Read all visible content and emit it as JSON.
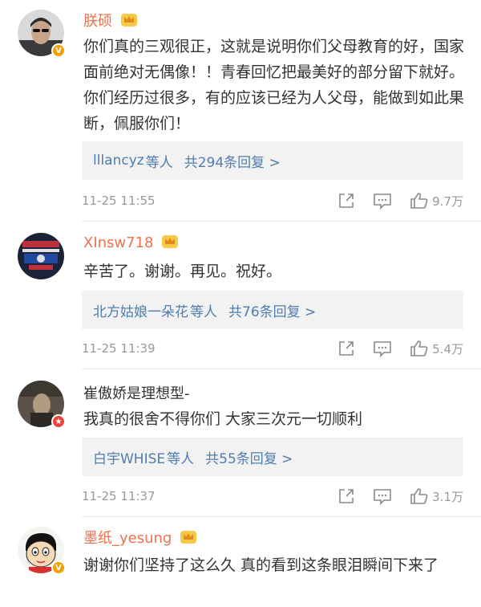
{
  "comments": [
    {
      "username": "朕硕",
      "vip": true,
      "badge": "V",
      "text": "你们真的三观很正，这就是说明你们父母教育的好，国家面前绝对无偶像！！青春回忆把最美好的部分留下就好。你们经历过很多，有的应该已经为人父母，能做到如此果断，佩服你们！",
      "reply_user": "lllancyz",
      "reply_others": "等人",
      "reply_count": "共294条回复 >",
      "time": "11-25 11:55",
      "likes": "9.7万"
    },
    {
      "username": "XInsw718",
      "vip": true,
      "badge": "",
      "text": "辛苦了。谢谢。再见。祝好。",
      "reply_user": "北方姑娘一朵花",
      "reply_others": "等人",
      "reply_count": "共76条回复 >",
      "time": "11-25 11:39",
      "likes": "5.4万"
    },
    {
      "username": "崔傲娇是理想型-",
      "vip": false,
      "badge": "★",
      "text": "我真的很舍不得你们 大家三次元一切顺利",
      "reply_user": "白宇WHISE",
      "reply_others": "等人",
      "reply_count": "共55条回复 >",
      "time": "11-25 11:37",
      "likes": "3.1万"
    },
    {
      "username": "墨纸_yesung",
      "vip": true,
      "badge": "V",
      "text": "谢谢你们坚持了这么久 真的看到这条眼泪瞬间下来了"
    }
  ],
  "colors": {
    "vip_name": "#eb7350",
    "link": "#507daf",
    "reply_bg": "#f2f2f2",
    "meta": "#999999"
  },
  "icons": [
    "share-icon",
    "comment-icon",
    "like-icon",
    "crown-icon",
    "verified-badge-icon"
  ]
}
